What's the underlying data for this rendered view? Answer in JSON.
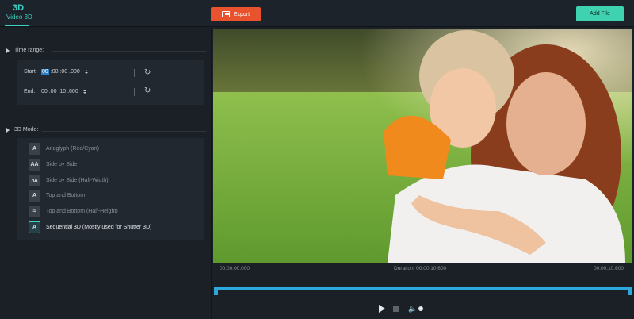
{
  "header": {
    "tab_big": "3D",
    "tab_small": "Video 3D",
    "export_label": "Export",
    "addfile_label": "Add File"
  },
  "time_range": {
    "heading": "Time range:",
    "start_label": "Start:",
    "start_hl": "00",
    "start_rest": ":00 :00 .000",
    "end_label": "End:",
    "end_value": "00 :00 :10 .600"
  },
  "mode": {
    "heading": "3D Mode:",
    "items": [
      {
        "label": "Anaglyph (Red/Cyan)",
        "icon": "anaglyph-icon",
        "glyph": "A"
      },
      {
        "label": "Side by Side",
        "icon": "side-by-side-icon",
        "glyph": "AA"
      },
      {
        "label": "Side by Side (Half-Width)",
        "icon": "side-by-side-half-icon",
        "glyph": "ʌʌ"
      },
      {
        "label": "Top and Bottom",
        "icon": "top-bottom-icon",
        "glyph": "A"
      },
      {
        "label": "Top and Bottom (Half-Height)",
        "icon": "top-bottom-half-icon",
        "glyph": "≈"
      },
      {
        "label": "Sequential 3D (Mostly used for Shutter 3D)",
        "icon": "sequential-icon",
        "glyph": "A"
      }
    ],
    "selected_index": 5
  },
  "player": {
    "time_left": "00:00:00.000",
    "duration": "Duration: 00:00:10.600",
    "time_right": "00:00:10.600",
    "volume": 0.05
  },
  "colors": {
    "accent": "#3fd2c7",
    "export": "#e8522c",
    "timeline": "#2ea8dc"
  }
}
